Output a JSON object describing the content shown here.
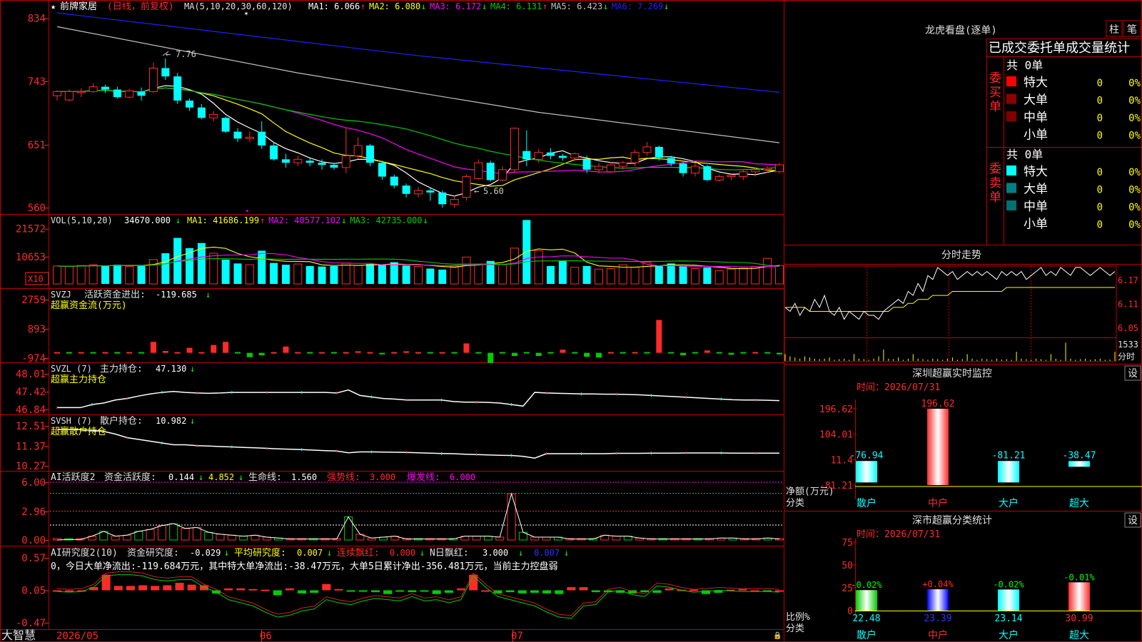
{
  "app": {
    "brand": "大智慧",
    "first_date": "2026/05",
    "month_labels": [
      "06",
      "07"
    ]
  },
  "colors": {
    "up": "#ff2a2a",
    "down": "#00ffff",
    "ma1": "#ffffff",
    "ma2": "#ffff00",
    "ma3": "#ff00ff",
    "ma4": "#00cc00",
    "ma5": "#c0c0c0",
    "ma6": "#2020ff",
    "frame": "#c00000",
    "green": "#00cc00"
  },
  "kline": {
    "star": "★",
    "title": "前牌家居",
    "mode": "(日线，前复权)",
    "ma_def": "MA(5,10,20,30,60,120)",
    "ma": [
      {
        "label": "MA1:",
        "value": "6.066",
        "dir": "↑"
      },
      {
        "label": "MA2:",
        "value": "6.080",
        "dir": "↓"
      },
      {
        "label": "MA3:",
        "value": "6.172",
        "dir": "↓"
      },
      {
        "label": "MA4:",
        "value": "6.131",
        "dir": "↑"
      },
      {
        "label": "MA5:",
        "value": "6.423",
        "dir": "↓"
      },
      {
        "label": "MA6:",
        "value": "7.269",
        "dir": "↓"
      }
    ],
    "yticks": [
      "834",
      "743",
      "651",
      "560"
    ],
    "high_label": "7.76",
    "low_label": "5.60",
    "price_range": [
      5.55,
      8.42
    ],
    "candles": [
      [
        7.22,
        7.28,
        7.15,
        7.3
      ],
      [
        7.16,
        7.28,
        7.14,
        7.31
      ],
      [
        7.28,
        7.28,
        7.2,
        7.33
      ],
      [
        7.28,
        7.35,
        7.26,
        7.4
      ],
      [
        7.35,
        7.31,
        7.26,
        7.38
      ],
      [
        7.31,
        7.2,
        7.18,
        7.35
      ],
      [
        7.2,
        7.29,
        7.18,
        7.32
      ],
      [
        7.28,
        7.22,
        7.15,
        7.34
      ],
      [
        7.28,
        7.62,
        7.26,
        7.7
      ],
      [
        7.62,
        7.5,
        7.45,
        7.76
      ],
      [
        7.5,
        7.15,
        7.1,
        7.55
      ],
      [
        7.15,
        7.05,
        7.0,
        7.18
      ],
      [
        7.05,
        6.9,
        6.88,
        7.1
      ],
      [
        6.9,
        6.95,
        6.85,
        7.0
      ],
      [
        6.9,
        6.7,
        6.68,
        6.92
      ],
      [
        6.7,
        6.6,
        6.55,
        6.75
      ],
      [
        6.6,
        6.62,
        6.55,
        6.7
      ],
      [
        6.7,
        6.5,
        6.45,
        6.85
      ],
      [
        6.5,
        6.3,
        6.28,
        6.55
      ],
      [
        6.3,
        6.25,
        6.18,
        6.38
      ],
      [
        6.25,
        6.3,
        6.2,
        6.35
      ],
      [
        6.28,
        6.25,
        6.2,
        6.32
      ],
      [
        6.25,
        6.22,
        6.15,
        6.3
      ],
      [
        6.22,
        6.18,
        6.15,
        6.25
      ],
      [
        6.18,
        6.35,
        6.1,
        6.75
      ],
      [
        6.35,
        6.5,
        6.3,
        6.62
      ],
      [
        6.5,
        6.25,
        6.2,
        6.52
      ],
      [
        6.25,
        6.05,
        6.0,
        6.28
      ],
      [
        6.05,
        5.92,
        5.88,
        6.08
      ],
      [
        5.92,
        5.8,
        5.75,
        5.95
      ],
      [
        5.8,
        5.85,
        5.75,
        5.9
      ],
      [
        5.85,
        5.82,
        5.7,
        5.9
      ],
      [
        5.82,
        5.65,
        5.6,
        5.85
      ],
      [
        5.65,
        5.72,
        5.6,
        5.78
      ],
      [
        5.75,
        6.05,
        5.7,
        6.08
      ],
      [
        6.02,
        6.25,
        6.0,
        6.3
      ],
      [
        6.25,
        6.0,
        5.98,
        6.28
      ],
      [
        6.0,
        6.15,
        5.98,
        6.2
      ],
      [
        6.15,
        6.75,
        6.1,
        6.76
      ],
      [
        6.42,
        6.3,
        6.2,
        6.72
      ],
      [
        6.3,
        6.4,
        6.25,
        6.45
      ],
      [
        6.4,
        6.35,
        6.3,
        6.46
      ],
      [
        6.35,
        6.32,
        6.28,
        6.38
      ],
      [
        6.32,
        6.38,
        6.28,
        6.4
      ],
      [
        6.3,
        6.15,
        6.1,
        6.35
      ],
      [
        6.15,
        6.2,
        6.1,
        6.25
      ],
      [
        6.12,
        6.22,
        6.1,
        6.26
      ],
      [
        6.2,
        6.25,
        6.15,
        6.28
      ],
      [
        6.25,
        6.4,
        6.2,
        6.44
      ],
      [
        6.4,
        6.48,
        6.35,
        6.55
      ],
      [
        6.48,
        6.32,
        6.28,
        6.5
      ],
      [
        6.32,
        6.24,
        6.2,
        6.35
      ],
      [
        6.24,
        6.1,
        6.05,
        6.26
      ],
      [
        6.1,
        6.2,
        6.05,
        6.25
      ],
      [
        6.2,
        6.0,
        5.98,
        6.22
      ],
      [
        6.0,
        6.05,
        5.98,
        6.08
      ],
      [
        6.05,
        6.07,
        6.0,
        6.1
      ],
      [
        6.05,
        6.12,
        6.0,
        6.15
      ],
      [
        6.12,
        6.15,
        6.05,
        6.18
      ],
      [
        6.15,
        6.17,
        6.1,
        6.2
      ],
      [
        6.12,
        6.22,
        6.1,
        6.25
      ]
    ]
  },
  "vol": {
    "label": "VOL(5,10,20)",
    "value": "34670.000",
    "value_dir": "↓",
    "ma": [
      {
        "label": "MA1:",
        "value": "41686.199",
        "dir": "↑"
      },
      {
        "label": "MA2:",
        "value": "40577.102",
        "dir": "↓"
      },
      {
        "label": "MA3:",
        "value": "42735.000",
        "dir": "↓"
      }
    ],
    "yticks": [
      "21572",
      "10653"
    ],
    "unit": "X10",
    "max": 24000,
    "values": [
      7000,
      6800,
      7200,
      7500,
      7000,
      7500,
      6800,
      7200,
      9500,
      12000,
      18000,
      14000,
      16000,
      12000,
      9500,
      8000,
      7500,
      13000,
      8200,
      7500,
      7800,
      7000,
      6800,
      7000,
      8200,
      7200,
      7800,
      7500,
      8500,
      7200,
      6800,
      6000,
      5600,
      7000,
      10500,
      7800,
      9000,
      7500,
      14000,
      25000,
      13000,
      7000,
      9000,
      6500,
      7000,
      5800,
      6000,
      7500,
      6500,
      8500,
      7000,
      8000,
      7000,
      6000,
      6500,
      5200,
      5800,
      6200,
      6800,
      10000,
      7200
    ]
  },
  "svzj": {
    "label": "SVZJ",
    "title": "活跃资金进出:",
    "value": "-119.685",
    "dir": "↓",
    "subtitle": "超赢资金流(万元)",
    "yticks": [
      "2759",
      "893",
      "-974"
    ],
    "range": [
      -974,
      2759
    ],
    "values": [
      0,
      0,
      0,
      0,
      0,
      0,
      0,
      0,
      700,
      120,
      0,
      320,
      0,
      500,
      700,
      0,
      -280,
      -150,
      0,
      400,
      0,
      0,
      0,
      0,
      0,
      100,
      0,
      -100,
      0,
      100,
      0,
      0,
      0,
      0,
      600,
      0,
      -650,
      0,
      -200,
      0,
      -200,
      0,
      200,
      0,
      -250,
      -300,
      0,
      0,
      0,
      0,
      2100,
      0,
      -150,
      0,
      150,
      0,
      -120,
      0,
      0,
      0,
      -100
    ]
  },
  "svzl": {
    "label": "SVZL (7)",
    "title": "主力持仓:",
    "value": "47.130",
    "dir": "↓",
    "subtitle": "超赢主力持仓",
    "yticks": [
      "48.01",
      "47.42",
      "46.84"
    ],
    "range": [
      46.84,
      48.01
    ],
    "values": [
      46.9,
      46.9,
      46.9,
      47.0,
      47.05,
      47.15,
      47.2,
      47.28,
      47.35,
      47.4,
      47.43,
      47.4,
      47.38,
      47.37,
      47.38,
      47.4,
      47.4,
      47.4,
      47.4,
      47.4,
      47.4,
      47.4,
      47.4,
      47.4,
      47.38,
      47.48,
      47.3,
      47.25,
      47.2,
      47.18,
      47.15,
      47.15,
      47.15,
      47.15,
      47.1,
      47.08,
      47.08,
      47.07,
      47.05,
      47.0,
      46.95,
      47.4,
      47.38,
      47.37,
      47.36,
      47.35,
      47.35,
      47.34,
      47.34,
      47.33,
      47.32,
      47.3,
      47.28,
      47.26,
      47.24,
      47.22,
      47.2,
      47.18,
      47.16,
      47.15,
      47.15,
      47.14,
      47.13
    ]
  },
  "svsh": {
    "label": "SVSH (7)",
    "title": "散户持仓:",
    "value": "10.982",
    "dir": "↓",
    "subtitle": "超赢散户持仓",
    "yticks": [
      "12.51",
      "11.37",
      "10.27"
    ],
    "range": [
      10.27,
      12.51
    ],
    "values": [
      12.3,
      12.3,
      12.3,
      12.25,
      12.2,
      12.05,
      11.85,
      11.75,
      11.65,
      11.55,
      11.45,
      11.45,
      11.4,
      11.38,
      11.35,
      11.33,
      11.3,
      11.28,
      11.25,
      11.22,
      11.2,
      11.18,
      11.15,
      11.12,
      11.1,
      11.0,
      11.05,
      11.05,
      11.04,
      11.03,
      11.02,
      11.0,
      10.98,
      10.96,
      10.95,
      10.92,
      10.9,
      10.88,
      10.86,
      10.85,
      10.8,
      10.7,
      10.95,
      10.95,
      10.95,
      10.95,
      10.95,
      10.95,
      10.97,
      10.97,
      10.97,
      10.98,
      10.98,
      10.98,
      10.99,
      10.99,
      10.99,
      10.99,
      10.98,
      10.98,
      10.98,
      10.98,
      10.98
    ]
  },
  "ai_active": {
    "label": "AI活跃度2",
    "title": "资金活跃度:",
    "value": "0.144",
    "dir": "↓",
    "v2": "4.852",
    "v2_dir": "↓",
    "life_label": "生命线:",
    "life": "1.560",
    "strong_label": "强势线:",
    "strong": "3.000",
    "burst_label": "爆发线:",
    "burst": "6.000",
    "yticks": [
      "6.00",
      "2.96",
      "0.00"
    ],
    "range": [
      0,
      6.3
    ],
    "levels": {
      "life": 1.56,
      "strong": 3.0,
      "green": 4.852,
      "burst": 6.0
    },
    "values": [
      0,
      0.05,
      0.05,
      0.4,
      0.9,
      0.4,
      0.5,
      0.9,
      1.1,
      1.5,
      1.7,
      1.2,
      1.3,
      0.8,
      0.6,
      0.5,
      0.4,
      0.5,
      0.3,
      0.2,
      0.1,
      0.1,
      0.1,
      0.1,
      0.1,
      2.4,
      0.6,
      0.2,
      0.3,
      0.4,
      0.1,
      0.1,
      0.1,
      0.1,
      0.1,
      0.4,
      0.4,
      0.4,
      0.3,
      4.8,
      0.8,
      0.3,
      0.3,
      0.3,
      0.1,
      0.1,
      0.1,
      0.5,
      0.4,
      0.4,
      0.2,
      0.1,
      0.1,
      0.1,
      0.1,
      0.1,
      0.1,
      0.2,
      0.2,
      0.1,
      0.1,
      0.2,
      0.1
    ]
  },
  "ai_research": {
    "label": "AI研究度2(10)",
    "title": "资金研究度:",
    "value": "-0.029",
    "dir": "↓",
    "avg_label": "平均研究度:",
    "avg": "0.007",
    "avg_dir": "↓",
    "red_label": "连续飘红:",
    "red": "0.000",
    "red_dir": "↓",
    "nred_label": "N日飘红:",
    "nred": "3.000",
    "nred_dir": "↓",
    "last": "0.007",
    "last_dir": "↓",
    "summary": "0，今日大单净流出:-119.684万元，其中特大单净流出:-38.47万元，大单5日累计净出-356.481万元，当前主力控盘弱",
    "yticks": [
      "0.57",
      "0.05",
      "-0.47"
    ],
    "range": [
      -0.47,
      0.57
    ],
    "bars": [
      0,
      0,
      0,
      0.05,
      0.25,
      0.07,
      0.07,
      0.08,
      0.07,
      0.08,
      0.12,
      0.09,
      0.08,
      -0.05,
      0.03,
      0.03,
      0.02,
      0.01,
      -0.08,
      0.03,
      -0.05,
      -0.04,
      0.1,
      0.02,
      -0.01,
      -0.02,
      -0.03,
      -0.06,
      -0.02,
      -0.03,
      -0.02,
      -0.06,
      -0.04,
      0.03,
      0.25,
      0.0,
      -0.05,
      -0.03,
      -0.05,
      -0.04,
      -0.05,
      -0.06,
      0.05,
      0.05,
      -0.03,
      -0.03,
      -0.04,
      -0.05,
      -0.03,
      -0.04,
      0.03,
      0.01,
      0.01,
      -0.06,
      -0.04,
      0.01,
      0.02,
      0.0,
      -0.01,
      0.0
    ],
    "line": [
      0.03,
      0.02,
      0.03,
      0.1,
      0.28,
      0.3,
      0.3,
      0.28,
      0.22,
      0.2,
      0.22,
      0.22,
      0.1,
      0.02,
      -0.1,
      -0.15,
      -0.2,
      -0.3,
      -0.38,
      -0.35,
      -0.28,
      -0.25,
      -0.1,
      -0.15,
      -0.18,
      -0.12,
      -0.08,
      -0.1,
      -0.12,
      -0.05,
      -0.12,
      -0.1,
      -0.15,
      -0.1,
      0.28,
      0.1,
      -0.05,
      -0.1,
      -0.15,
      -0.2,
      -0.3,
      -0.38,
      -0.4,
      -0.2,
      -0.18,
      0.02,
      0.05,
      -0.02,
      -0.05,
      0.12,
      0.1,
      0.05,
      0.02,
      0.03,
      0.05,
      0.04,
      0.03,
      0.03,
      0.03,
      0.02
    ]
  },
  "right": {
    "tiger_title": "龙虎看盘(逐单)",
    "btn_bar": "柱",
    "btn_tick": "笔",
    "stats_title": "已成交委托单成交量统计",
    "buy_side": "委买单",
    "sell_side": "委卖单",
    "buy_total": "共 0单",
    "sell_total": "共 0单",
    "buy_rows": [
      {
        "label": "特大",
        "value": "0",
        "pct": "0%",
        "color": "#ff0000"
      },
      {
        "label": "大单",
        "value": "0",
        "pct": "0%",
        "color": "#8b0000"
      },
      {
        "label": "中单",
        "value": "0",
        "pct": "0%",
        "color": "#800000"
      },
      {
        "label": "小单",
        "value": "0",
        "pct": "0%",
        "color": ""
      }
    ],
    "sell_rows": [
      {
        "label": "特大",
        "value": "0",
        "pct": "0%",
        "color": "#00ffff"
      },
      {
        "label": "大单",
        "value": "0",
        "pct": "0%",
        "color": "#008080"
      },
      {
        "label": "中单",
        "value": "0",
        "pct": "0%",
        "color": "#007070"
      },
      {
        "label": "小单",
        "value": "0",
        "pct": "0%",
        "color": ""
      }
    ],
    "intraday_title": "分时走势",
    "intraday_yticks": [
      "6.17",
      "6.11",
      "6.05"
    ],
    "intraday_vol_label": "1533",
    "intraday_vol_unit": "分时",
    "intraday_range": [
      6.03,
      6.2
    ],
    "intraday_price": [
      6.1,
      6.09,
      6.11,
      6.08,
      6.1,
      6.09,
      6.12,
      6.1,
      6.13,
      6.09,
      6.08,
      6.1,
      6.07,
      6.09,
      6.08,
      6.07,
      6.09,
      6.08,
      6.08,
      6.07,
      6.09,
      6.1,
      6.11,
      6.12,
      6.11,
      6.14,
      6.13,
      6.16,
      6.14,
      6.18,
      6.17,
      6.2,
      6.19,
      6.18,
      6.19,
      6.17,
      6.18,
      6.19,
      6.18,
      6.19,
      6.18,
      6.19,
      6.18,
      6.17,
      6.19,
      6.18,
      6.19,
      6.18,
      6.19,
      6.17,
      6.18,
      6.19,
      6.2,
      6.18,
      6.19,
      6.18,
      6.2,
      6.19,
      6.18,
      6.2,
      6.2,
      6.19,
      6.18,
      6.19,
      6.2,
      6.19,
      6.18,
      6.19
    ],
    "intraday_avg": [
      6.1,
      6.1,
      6.1,
      6.1,
      6.1,
      6.09,
      6.09,
      6.09,
      6.09,
      6.09,
      6.09,
      6.09,
      6.09,
      6.09,
      6.09,
      6.09,
      6.09,
      6.09,
      6.09,
      6.09,
      6.09,
      6.09,
      6.1,
      6.1,
      6.1,
      6.11,
      6.11,
      6.12,
      6.12,
      6.12,
      6.13,
      6.13,
      6.13,
      6.13,
      6.14,
      6.14,
      6.14,
      6.14,
      6.14,
      6.14,
      6.14,
      6.14,
      6.14,
      6.14,
      6.14,
      6.15,
      6.15,
      6.15,
      6.15,
      6.15,
      6.15,
      6.15,
      6.15,
      6.15,
      6.15,
      6.15,
      6.15,
      6.15,
      6.15,
      6.15,
      6.15,
      6.15,
      6.15,
      6.15,
      6.15,
      6.15,
      6.15,
      6.15
    ],
    "intraday_vol": [
      0.3,
      0.2,
      0.15,
      0.1,
      0.2,
      0.15,
      0.1,
      0.08,
      0.1,
      0.15,
      0.05,
      0.08,
      0.1,
      0.05,
      0.3,
      0.1,
      0.08,
      0.05,
      0.1,
      0.2,
      0.5,
      0.1,
      0.08,
      0.15,
      0.05,
      0.1,
      0.3,
      0.1,
      0.08,
      0.05,
      0.1,
      0.08,
      0.05,
      0.1,
      0.15,
      0.05,
      0.08,
      0.3,
      0.1,
      0.05,
      0.1,
      0.08,
      0.05,
      0.1,
      0.06,
      0.08,
      0.05,
      0.4,
      0.1,
      0.08,
      0.05,
      0.1,
      0.08,
      0.05,
      0.3,
      0.1,
      0.05,
      0.8,
      0.1,
      0.05,
      0.08,
      0.1,
      0.05,
      0.08,
      0.1,
      0.05,
      0.06,
      0.4
    ],
    "sz_title": "深圳超赢实时监控",
    "sz_time": "时间：2026/07/31",
    "sz_yticks": [
      "196.62",
      "104.01",
      "11.4",
      "-81.21"
    ],
    "sz_range": [
      -81.21,
      196.62
    ],
    "sz_axis_label": "净额(万元)",
    "sz_cat_label": "分类",
    "sz_bars": [
      {
        "cat": "散户",
        "value": -76.94,
        "label": "-76.94",
        "color": "#00ffff"
      },
      {
        "cat": "中户",
        "value": 196.62,
        "label": "196.62",
        "color": "#ff2a2a"
      },
      {
        "cat": "大户",
        "value": -81.21,
        "label": "-81.21",
        "color": "#00ffff"
      },
      {
        "cat": "超大",
        "value": -38.47,
        "label": "-38.47",
        "color": "#00ffff"
      }
    ],
    "sz_btn": "设",
    "cls_title": "深市超赢分类统计",
    "cls_time": "时间：2026/07/31",
    "cls_yticks": [
      "75",
      "50",
      "25",
      "0"
    ],
    "cls_axis_label": "比例%",
    "cls_cat_label": "分类",
    "cls_btn": "设",
    "cls_bars": [
      {
        "cat": "散户",
        "value": 22.48,
        "label": "22.48",
        "change": "-0.02%",
        "color": "#00cc00",
        "change_color": "#00ff00"
      },
      {
        "cat": "中户",
        "value": 23.39,
        "label": "23.39",
        "change": "+0.04%",
        "color": "#0000ff",
        "change_color": "#ff2a2a"
      },
      {
        "cat": "大户",
        "value": 23.14,
        "label": "23.14",
        "change": "-0.02%",
        "color": "#00ffff",
        "change_color": "#00ff00"
      },
      {
        "cat": "超大",
        "value": 30.99,
        "label": "30.99",
        "change": "-0.01%",
        "color": "#ff2a2a",
        "change_color": "#00ff00"
      }
    ]
  }
}
